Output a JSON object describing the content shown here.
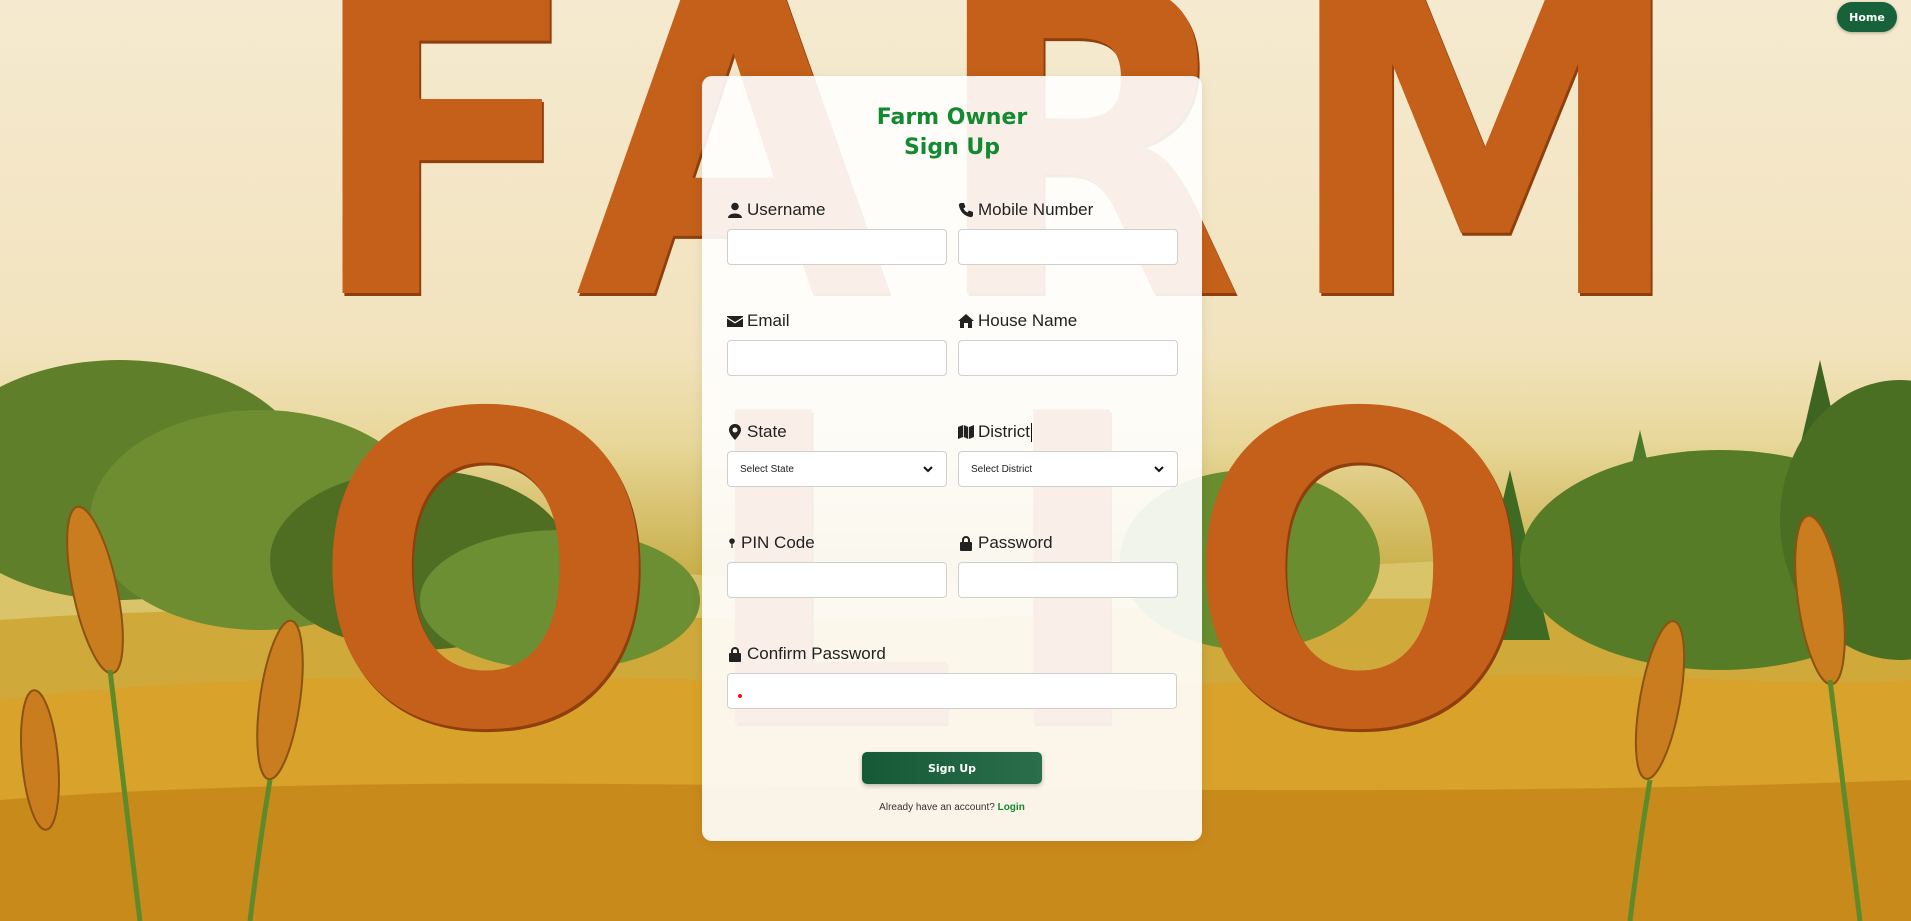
{
  "background": {
    "title": "FARM OLIO"
  },
  "nav": {
    "home_label": "Home"
  },
  "form": {
    "title_line1": "Farm Owner",
    "title_line2": "Sign Up",
    "fields": {
      "username": {
        "label": "Username",
        "icon": "user-icon",
        "value": ""
      },
      "mobile": {
        "label": "Mobile Number",
        "icon": "phone-icon",
        "value": ""
      },
      "email": {
        "label": "Email",
        "icon": "envelope-icon",
        "value": ""
      },
      "house": {
        "label": "House Name",
        "icon": "home-icon",
        "value": ""
      },
      "state": {
        "label": "State",
        "icon": "map-marker-icon",
        "selected": "Select State"
      },
      "district": {
        "label": "District",
        "icon": "map-icon",
        "selected": "Select District"
      },
      "pin": {
        "label": "PIN Code",
        "icon": "map-pin-icon",
        "value": ""
      },
      "password": {
        "label": "Password",
        "icon": "lock-icon",
        "value": ""
      },
      "confirm": {
        "label": "Confirm Password",
        "icon": "lock-icon",
        "value": ""
      }
    },
    "submit_label": "Sign Up",
    "login_prompt": "Already have an account?",
    "login_link": "Login"
  },
  "colors": {
    "accent": "#138a30",
    "button": "#17623a",
    "title_art": "#c4601a"
  }
}
